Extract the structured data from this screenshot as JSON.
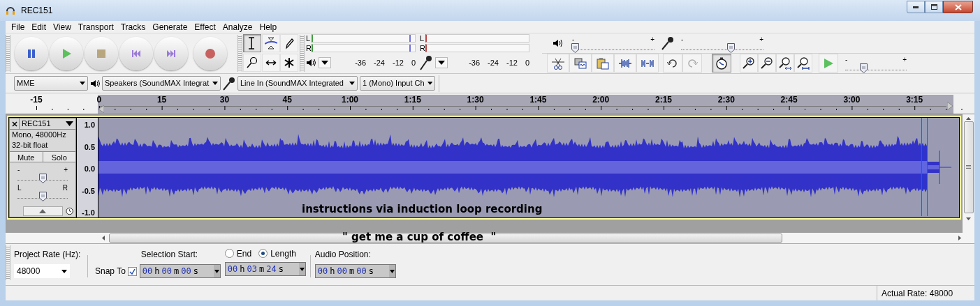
{
  "window": {
    "title": "REC151"
  },
  "menu": [
    "File",
    "Edit",
    "View",
    "Transport",
    "Tracks",
    "Generate",
    "Effect",
    "Analyze",
    "Help"
  ],
  "tools": [
    {
      "kind": "select",
      "selected": true
    },
    {
      "kind": "envelope",
      "selected": false
    },
    {
      "kind": "draw",
      "selected": false
    },
    {
      "kind": "zoom",
      "selected": false
    },
    {
      "kind": "timeshift",
      "selected": false
    },
    {
      "kind": "multi",
      "selected": false
    }
  ],
  "meters": [
    {
      "kind": "playback",
      "channels": [
        "L",
        "R"
      ],
      "scale": [
        "-36",
        "-24",
        "-12",
        "0"
      ]
    },
    {
      "kind": "recording",
      "channels": [
        "L",
        "R"
      ],
      "scale": [
        "-36",
        "-24",
        "-12",
        "0"
      ]
    }
  ],
  "mixer": {
    "playback_volume": {
      "level": 0.03,
      "min_label": "-",
      "max_label": "+"
    },
    "recording_volume": {
      "level": 0.6,
      "min_label": "-",
      "max_label": "+"
    }
  },
  "edit_toolbar": {
    "undo_disabled": false,
    "redo_disabled": true,
    "sync_lock_on": true
  },
  "play_at_speed": {
    "level": 0.3,
    "min_label": "-",
    "max_label": "+"
  },
  "devices": {
    "host": "MME",
    "output": "Speakers (SoundMAX Integrat",
    "input": "Line In (SoundMAX Integrated",
    "channels": "1 (Mono) Input Ch"
  },
  "ruler": {
    "labels": [
      "-15",
      "0",
      "15",
      "30",
      "45",
      "1:00",
      "1:15",
      "1:30",
      "1:45",
      "2:00",
      "2:15",
      "2:30",
      "2:45",
      "3:00",
      "3:15"
    ]
  },
  "track": {
    "name": "REC151",
    "info": [
      "Mono, 48000Hz",
      "32-bit float"
    ],
    "mute": {
      "label": "Mute",
      "on": false
    },
    "solo": {
      "label": "Solo",
      "on": false
    },
    "gain": {
      "level": 0.5,
      "min_label": "-",
      "max_label": "+"
    },
    "pan": {
      "level": 0.5,
      "min_label": "L",
      "max_label": "R"
    },
    "scale": [
      "1.0",
      "0.5",
      "0.0",
      "-0.5",
      "-1.0"
    ]
  },
  "annotations": [
    "instructions via induction loop recording",
    "\" get me a cup of coffee  \""
  ],
  "selection_toolbar": {
    "project_rate_label": "Project Rate (Hz):",
    "project_rate": "48000",
    "snap_label": "Snap To",
    "snap_checked": true,
    "selection_start_label": "Selection Start:",
    "selection_start": "00 h 00 m 00 s",
    "modes": [
      {
        "label": "End",
        "selected": false
      },
      {
        "label": "Length",
        "selected": true
      }
    ],
    "length": "00 h 03 m 24 s",
    "audio_position_label": "Audio Position:",
    "audio_position": "00 h 00 m 00 s"
  },
  "status_bar": {
    "actual_rate": "Actual Rate: 48000"
  }
}
